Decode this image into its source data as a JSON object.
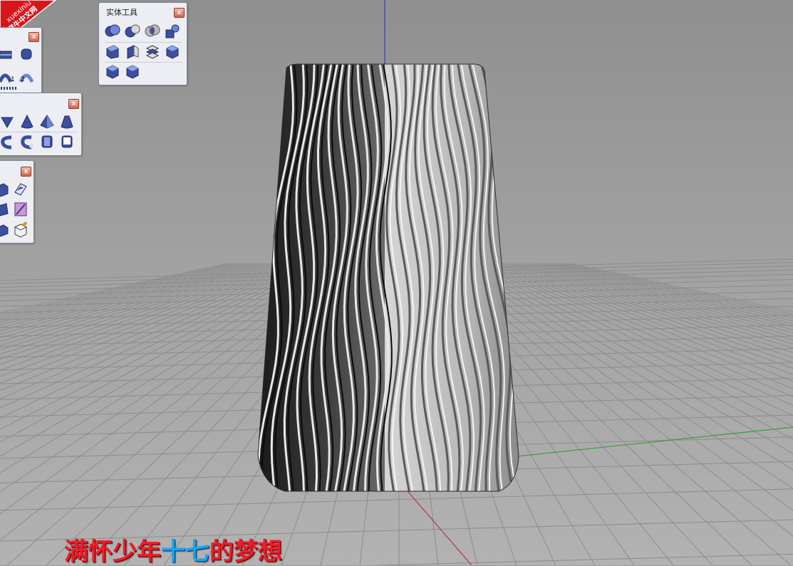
{
  "watermark": {
    "site": "xuexiniu",
    "site_cn": "学犀牛中文网"
  },
  "solid_tools_panel": {
    "title": "实体工具",
    "close_label": "x",
    "icons": [
      "boolean-union-icon",
      "boolean-difference-icon",
      "boolean-intersection-icon",
      "boolean-split-icon",
      "create-solid-icon",
      "extract-surface-icon",
      "cap-planar-holes-icon",
      "merge-faces-icon",
      "shell-solid-icon",
      "extrude-face-icon"
    ]
  },
  "surface_panel": {
    "close_label": "x",
    "labels": [
      "1",
      "2"
    ]
  },
  "solid_primitives_panel": {
    "close_label": "x",
    "icons": [
      "ellipsoid-icon",
      "cone-icon",
      "pyramid-icon",
      "truncated-cone-icon",
      "torus-icon",
      "pipe-icon",
      "cylinder-solid-icon",
      "tube-icon"
    ]
  },
  "extra_panel": {
    "close_label": "x",
    "icons": [
      "box-icon",
      "planar-surface-icon",
      "edge-surface-icon",
      "paint-icon",
      "extrude-icon",
      "cube-edit-icon"
    ]
  },
  "caption": {
    "part1": "满怀少年",
    "part2": "十七",
    "part3": "的梦想"
  },
  "colors": {
    "viewport_background": "#9d9d9d",
    "grid_line": "#8c8c8c",
    "x_axis": "#b33a3a",
    "y_axis": "#3d9d3d",
    "z_axis": "#3a3ab8",
    "caption_red": "#ee1d2a",
    "caption_blue": "#19a6ec"
  }
}
